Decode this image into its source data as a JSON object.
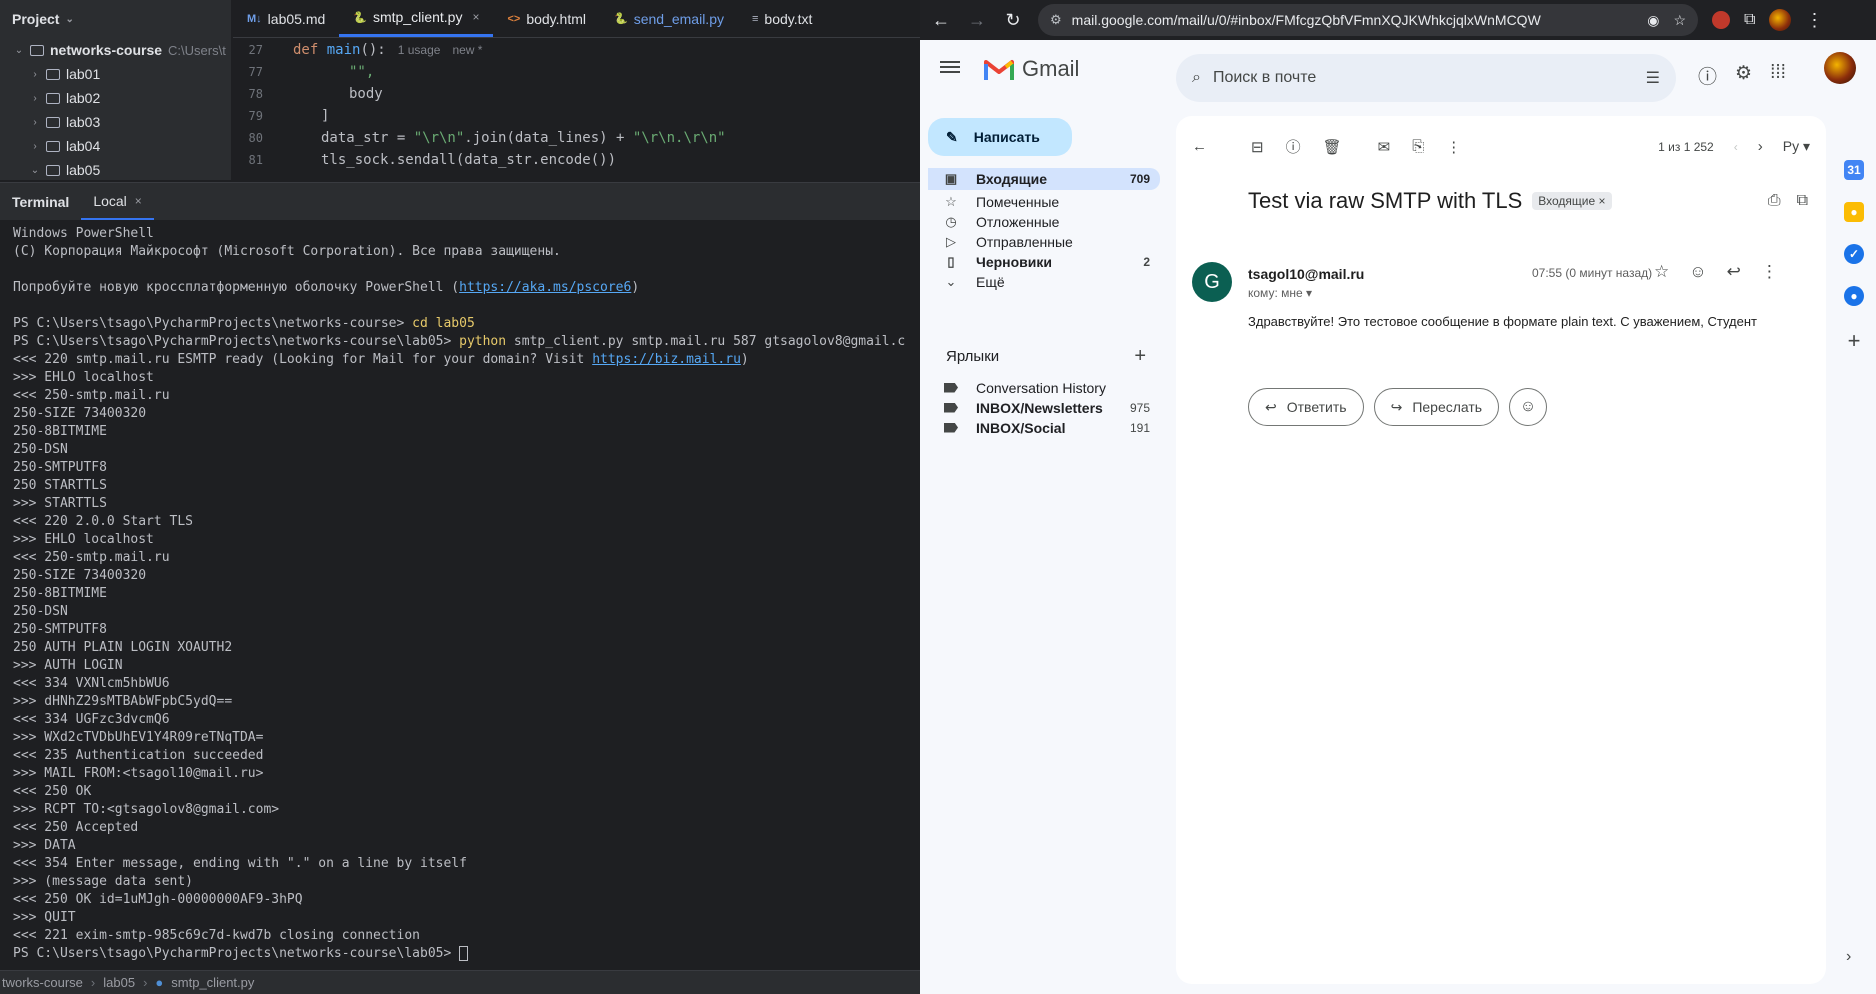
{
  "ide": {
    "project": {
      "title": "Project",
      "root_name": "networks-course",
      "root_path": "C:\\Users\\t",
      "folders": [
        "lab01",
        "lab02",
        "lab03",
        "lab04",
        "lab05"
      ]
    },
    "tabs": [
      {
        "icon": "M↓",
        "label": "lab05.md",
        "icon_name": "markdown-icon"
      },
      {
        "icon": "🐍",
        "label": "smtp_client.py",
        "icon_name": "python-icon",
        "active": true,
        "close": "×"
      },
      {
        "icon": "<>",
        "label": "body.html",
        "icon_name": "html-icon"
      },
      {
        "icon": "🐍",
        "label": "send_email.py",
        "icon_name": "python-icon"
      },
      {
        "icon": "≡",
        "label": "body.txt",
        "icon_name": "text-file-icon"
      }
    ],
    "editor": {
      "l27": {
        "num": "27",
        "kw": "def",
        "fn": "main",
        "rest": "():",
        "hint1": "1 usage",
        "hint2": "new *"
      },
      "l77": {
        "num": "77",
        "text": "\"\","
      },
      "l78": {
        "num": "78",
        "text": "body"
      },
      "l79": {
        "num": "79",
        "text": "]"
      },
      "l80": {
        "num": "80",
        "pre": "data_str = ",
        "s1": "\"\\r\\n\"",
        "mid": ".join(data_lines) + ",
        "s2": "\"\\r\\n.\\r\\n\""
      },
      "l81": {
        "num": "81",
        "text": "tls_sock.sendall(data_str.encode())"
      }
    },
    "terminal_tabs": {
      "title": "Terminal",
      "local": "Local",
      "close": "×"
    },
    "terminal": {
      "l1": "Windows PowerShell",
      "l2": "(C) Корпорация Майкрософт (Microsoft Corporation). Все права защищены.",
      "l3_pre": "Попробуйте новую кроссплатформенную оболочку PowerShell (",
      "l3_link": "https://aka.ms/pscore6",
      "l3_post": ")",
      "l4_prompt": "PS C:\\Users\\tsago\\PycharmProjects\\networks-course> ",
      "l4_cmd": "cd lab05",
      "l5_prompt": "PS C:\\Users\\tsago\\PycharmProjects\\networks-course\\lab05> ",
      "l5_cmd": "python",
      "l5_args": " smtp_client.py smtp.mail.ru 587 gtsagolov8@gmail.c",
      "l6_pre": "<<< 220 smtp.mail.ru ESMTP ready (Looking for Mail for your domain? Visit ",
      "l6_link": "https://biz.mail.ru",
      "l6_post": ")",
      "lines": [
        ">>> EHLO localhost",
        "<<< 250-smtp.mail.ru",
        "250-SIZE 73400320",
        "250-8BITMIME",
        "250-DSN",
        "250-SMTPUTF8",
        "250 STARTTLS",
        ">>> STARTTLS",
        "<<< 220 2.0.0 Start TLS",
        ">>> EHLO localhost",
        "<<< 250-smtp.mail.ru",
        "250-SIZE 73400320",
        "250-8BITMIME",
        "250-DSN",
        "250-SMTPUTF8",
        "250 AUTH PLAIN LOGIN XOAUTH2",
        ">>> AUTH LOGIN",
        "<<< 334 VXNlcm5hbWU6",
        ">>> dHNhZ29sMTBAbWFpbC5ydQ==",
        "<<< 334 UGFzc3dvcmQ6",
        ">>> WXd2cTVDbUhEV1Y4R09reTNqTDA=",
        "<<< 235 Authentication succeeded",
        ">>> MAIL FROM:<tsagol10@mail.ru>",
        "<<< 250 OK",
        ">>> RCPT TO:<gtsagolov8@gmail.com>",
        "<<< 250 Accepted",
        ">>> DATA",
        "<<< 354 Enter message, ending with \".\" on a line by itself",
        ">>> (message data sent)",
        "<<< 250 OK id=1uMJgh-00000000AF9-3hPQ",
        ">>> QUIT",
        "<<< 221 exim-smtp-985c69c7d-kwd7b closing connection"
      ],
      "last_prompt": "PS C:\\Users\\tsago\\PycharmProjects\\networks-course\\lab05> "
    },
    "statusbar": {
      "c1": "tworks-course",
      "sep": "›",
      "c2": "lab05",
      "c3": "smtp_client.py"
    }
  },
  "browser": {
    "url": "mail.google.com/mail/u/0/#inbox/FMfcgzQbfVFmnXQJKWhkcjqlxWnMCQW"
  },
  "gmail": {
    "brand": "Gmail",
    "search_placeholder": "Поиск в почте",
    "compose": "Написать",
    "nav": [
      {
        "icon": "▣",
        "icon_name": "inbox-icon",
        "label": "Входящие",
        "count": "709",
        "active": true
      },
      {
        "icon": "☆",
        "icon_name": "star-icon",
        "label": "Помеченные",
        "count": ""
      },
      {
        "icon": "◷",
        "icon_name": "clock-icon",
        "label": "Отложенные",
        "count": ""
      },
      {
        "icon": "▷",
        "icon_name": "send-icon",
        "label": "Отправленные",
        "count": ""
      },
      {
        "icon": "▯",
        "icon_name": "draft-icon",
        "label": "Черновики",
        "count": "2",
        "bold": true
      },
      {
        "icon": "⌄",
        "icon_name": "chevron-down-icon",
        "label": "Ещё",
        "count": ""
      }
    ],
    "labels_title": "Ярлыки",
    "labels_add": "+",
    "labels": [
      {
        "label": "Conversation History",
        "count": "",
        "bold": false
      },
      {
        "label": "INBOX/Newsletters",
        "count": "975",
        "bold": true
      },
      {
        "label": "INBOX/Social",
        "count": "191",
        "bold": true
      }
    ],
    "pager": "1 из 1 252",
    "lang": "Ру",
    "subject": "Test via raw SMTP with TLS",
    "label_chip": "Входящие ×",
    "sender_initial": "G",
    "sender": "tsagol10@mail.ru",
    "to": "кому: мне ▾",
    "time": "07:55 (0 минут назад)",
    "body": "Здравствуйте!  Это тестовое сообщение в формате plain text. С уважением, Студент",
    "reply": "Ответить",
    "forward": "Переслать",
    "colors": {
      "compose_bg": "#c2e7ff",
      "active_nav": "#d3e3fd",
      "avatar": "#0b5f52"
    }
  }
}
